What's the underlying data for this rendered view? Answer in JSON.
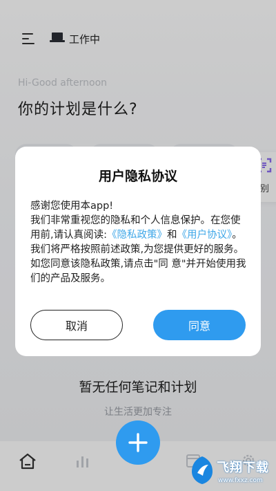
{
  "header": {
    "menu_icon": "menu-icon",
    "status_icon": "laptop-icon",
    "status_text": "工作中"
  },
  "greeting": "Hi-Good afternoon",
  "headline": "你的计划是什么?",
  "side_card": {
    "icon": "scan-icon",
    "label": "识别"
  },
  "dialog": {
    "title": "用户隐私协议",
    "line1": "感谢您使用本app!",
    "line2": " 我们非常重视您的隐私和个人信息保护。在您使用前,请认真阅读:",
    "privacy_link": "《隐私政策》",
    "and_text": "和",
    "agreement_link": "《用户协议》",
    "line3": "。我们将严格按照前述政策,为您提供更好的服务。如您同意该隐私政策,请点击\"同 意\"并开始使用我们的产品及服务。",
    "cancel_label": "取消",
    "agree_label": "同意"
  },
  "empty": {
    "title": "暂无任何笔记和计划",
    "subtitle": "让生活更加专注"
  },
  "bottom_nav": {
    "items": [
      "home-icon",
      "stats-icon",
      "calendar-icon",
      "settings-icon"
    ],
    "fab_icon": "plus-icon"
  },
  "watermark": {
    "text": "飞翔下载",
    "url": "www.fxxz.com"
  },
  "colors": {
    "accent": "#2f9bef",
    "link": "#3fa7e8"
  }
}
